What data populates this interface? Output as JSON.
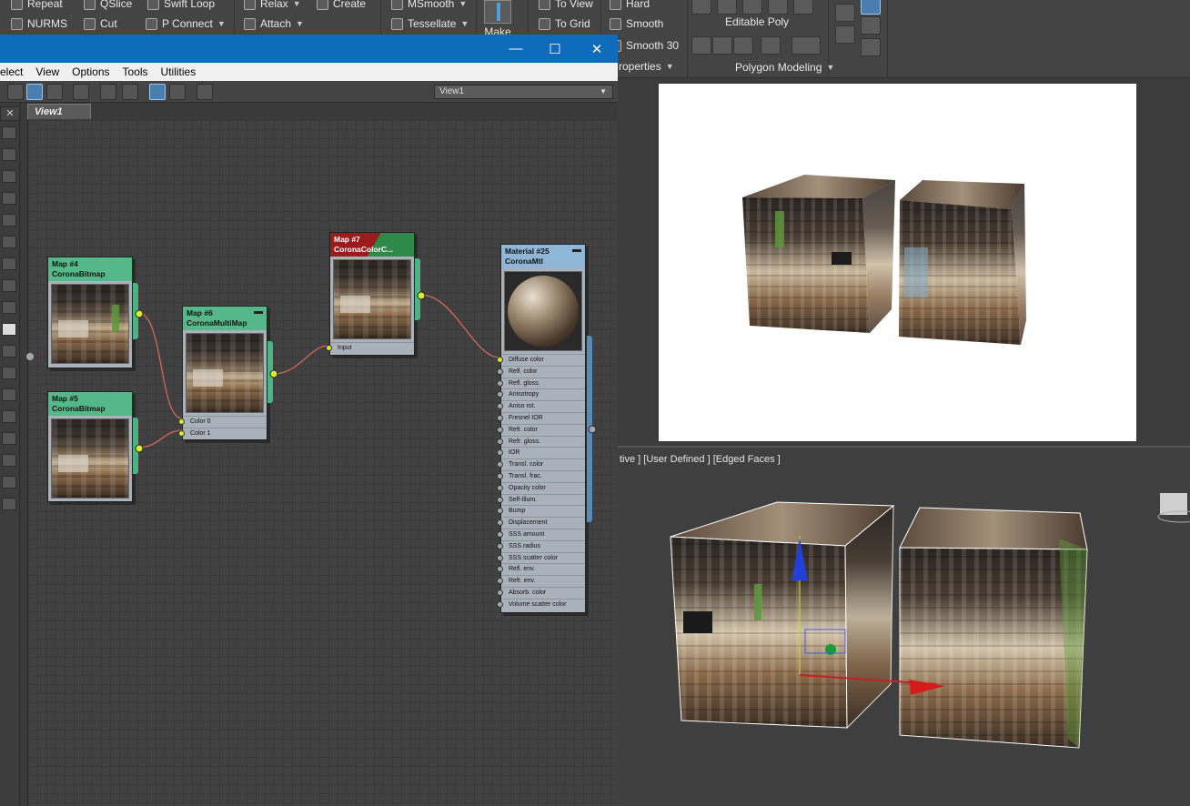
{
  "ribbon": {
    "row1": [
      "Repeat",
      "QSlice",
      "Swift Loop",
      "Relax",
      "Create",
      "MSmooth",
      "To View",
      "Hard"
    ],
    "row2": [
      "NURMS",
      "Cut",
      "P Connect",
      "Attach",
      "Tessellate",
      "To Grid",
      "Smooth"
    ],
    "row3": [
      "Smooth 30"
    ],
    "make_label": "Make",
    "editable_poly": "Editable Poly",
    "properties_label": "roperties",
    "polygon_modeling": "Polygon Modeling"
  },
  "window": {
    "minimize": "—",
    "maximize": "☐",
    "close": "✕",
    "menu": [
      "elect",
      "View",
      "Options",
      "Tools",
      "Utilities"
    ],
    "view_selector": "View1",
    "view_tab": "View1"
  },
  "nodes": {
    "map4": {
      "name": "Map #4",
      "type": "CoronaBitmap"
    },
    "map5": {
      "name": "Map #5",
      "type": "CoronaBitmap"
    },
    "map6": {
      "name": "Map #6",
      "type": "CoronaMultiMap",
      "slots": [
        "Color 0",
        "Color 1"
      ]
    },
    "map7": {
      "name": "Map #7",
      "type": "CoronaColorC...",
      "slots": [
        "Input"
      ]
    },
    "mat25": {
      "name": "Material #25",
      "type": "CoronaMtl",
      "slots": [
        "Diffuse color",
        "Refl. color",
        "Refl. gloss.",
        "Anisotropy",
        "Aniso rot.",
        "Fresnel IOR",
        "Refr. color",
        "Refr. gloss.",
        "IOR",
        "Transl. color",
        "Transl. frac.",
        "Opacity color",
        "Self-Illum.",
        "Bump",
        "Displacement",
        "SSS amount",
        "SSS radius",
        "SSS scatter color",
        "Refl. env.",
        "Refr. env.",
        "Absorb. color",
        "Volume scatter color"
      ]
    }
  },
  "viewport": {
    "label": "tive ] [User Defined ] [Edged Faces ]"
  },
  "colors": {
    "titlebar": "#0f6cbd",
    "node_green": "#55b889",
    "map7_red": "#9b1c1c",
    "wire": "#e06a5a",
    "socket_active": "#d7ef2a"
  }
}
